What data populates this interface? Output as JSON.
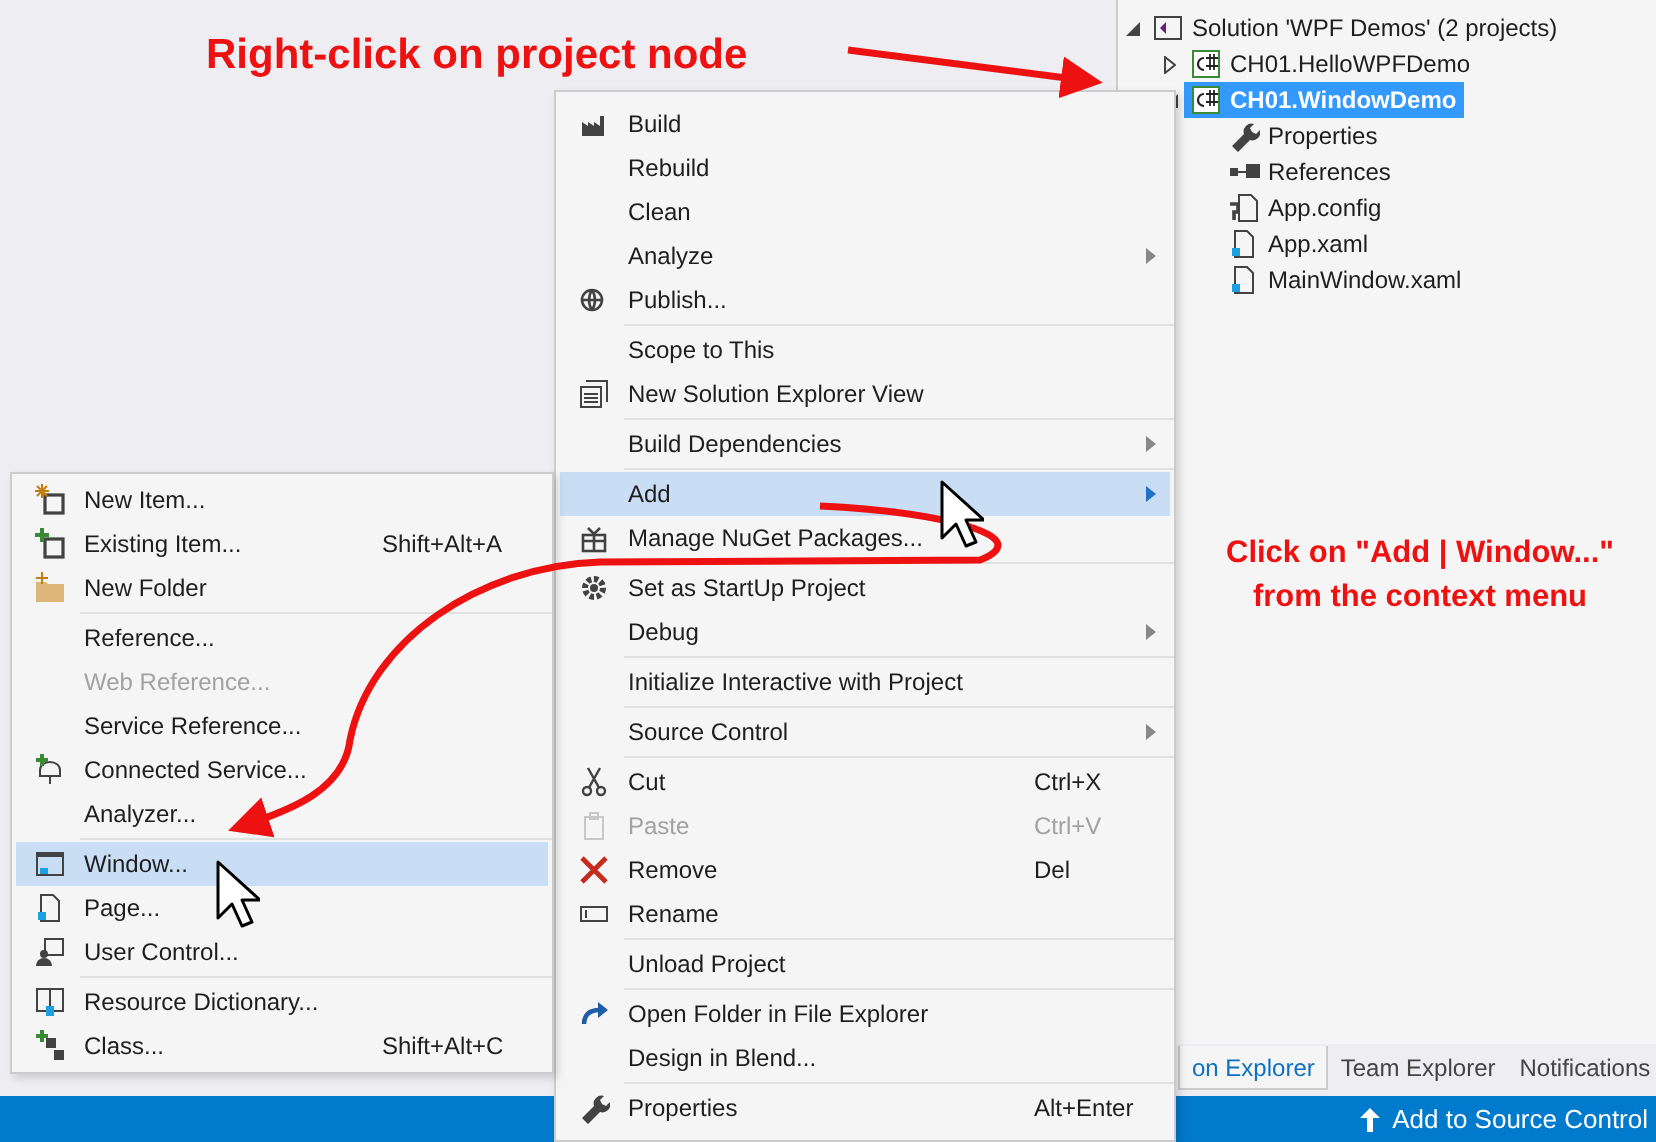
{
  "solution_explorer": {
    "tree": [
      {
        "label": "Solution 'WPF Demos' (2 projects)",
        "selected": false,
        "expanded": true,
        "children": [
          {
            "label": "CH01.HelloWPFDemo",
            "selected": false,
            "expanded": false
          },
          {
            "label": "CH01.WindowDemo",
            "selected": true,
            "expanded": true,
            "children": [
              {
                "label": "Properties",
                "selected": false
              },
              {
                "label": "References",
                "selected": false
              },
              {
                "label": "App.config",
                "selected": false
              },
              {
                "label": "App.xaml",
                "selected": false
              },
              {
                "label": "MainWindow.xaml",
                "selected": false
              }
            ]
          }
        ]
      }
    ],
    "tabs": [
      {
        "label": "on Explorer",
        "selected": true
      },
      {
        "label": "Team Explorer",
        "selected": false
      },
      {
        "label": "Notifications",
        "selected": false
      }
    ]
  },
  "status_bar": {
    "text": "Add to Source Control"
  },
  "context_menu": [
    {
      "kind": "item",
      "label": "Build",
      "submenu": false,
      "disabled": false,
      "selected": false
    },
    {
      "kind": "item",
      "label": "Rebuild",
      "submenu": false,
      "disabled": false,
      "selected": false
    },
    {
      "kind": "item",
      "label": "Clean",
      "submenu": false,
      "disabled": false,
      "selected": false
    },
    {
      "kind": "item",
      "label": "Analyze",
      "submenu": true,
      "disabled": false,
      "selected": false
    },
    {
      "kind": "item",
      "label": "Publish...",
      "submenu": false,
      "disabled": false,
      "selected": false
    },
    {
      "kind": "separator"
    },
    {
      "kind": "item",
      "label": "Scope to This",
      "submenu": false,
      "disabled": false,
      "selected": false
    },
    {
      "kind": "item",
      "label": "New Solution Explorer View",
      "submenu": false,
      "disabled": false,
      "selected": false
    },
    {
      "kind": "separator"
    },
    {
      "kind": "item",
      "label": "Build Dependencies",
      "submenu": true,
      "disabled": false,
      "selected": false
    },
    {
      "kind": "separator"
    },
    {
      "kind": "item",
      "label": "Add",
      "submenu": true,
      "disabled": false,
      "selected": true
    },
    {
      "kind": "item",
      "label": "Manage NuGet Packages...",
      "submenu": false,
      "disabled": false,
      "selected": false
    },
    {
      "kind": "separator"
    },
    {
      "kind": "item",
      "label": "Set as StartUp Project",
      "submenu": false,
      "disabled": false,
      "selected": false
    },
    {
      "kind": "item",
      "label": "Debug",
      "submenu": true,
      "disabled": false,
      "selected": false
    },
    {
      "kind": "separator"
    },
    {
      "kind": "item",
      "label": "Initialize Interactive with Project",
      "submenu": false,
      "disabled": false,
      "selected": false
    },
    {
      "kind": "separator"
    },
    {
      "kind": "item",
      "label": "Source Control",
      "submenu": true,
      "disabled": false,
      "selected": false
    },
    {
      "kind": "separator"
    },
    {
      "kind": "item",
      "label": "Cut",
      "shortcut": "Ctrl+X",
      "submenu": false,
      "disabled": false,
      "selected": false
    },
    {
      "kind": "item",
      "label": "Paste",
      "shortcut": "Ctrl+V",
      "submenu": false,
      "disabled": true,
      "selected": false
    },
    {
      "kind": "item",
      "label": "Remove",
      "shortcut": "Del",
      "submenu": false,
      "disabled": false,
      "selected": false
    },
    {
      "kind": "item",
      "label": "Rename",
      "submenu": false,
      "disabled": false,
      "selected": false
    },
    {
      "kind": "separator"
    },
    {
      "kind": "item",
      "label": "Unload Project",
      "submenu": false,
      "disabled": false,
      "selected": false
    },
    {
      "kind": "separator"
    },
    {
      "kind": "item",
      "label": "Open Folder in File Explorer",
      "submenu": false,
      "disabled": false,
      "selected": false
    },
    {
      "kind": "item",
      "label": "Design in Blend...",
      "submenu": false,
      "disabled": false,
      "selected": false
    },
    {
      "kind": "separator"
    },
    {
      "kind": "item",
      "label": "Properties",
      "shortcut": "Alt+Enter",
      "submenu": false,
      "disabled": false,
      "selected": false
    }
  ],
  "add_submenu": [
    {
      "kind": "item",
      "label": "New Item...",
      "disabled": false,
      "selected": false
    },
    {
      "kind": "item",
      "label": "Existing Item...",
      "shortcut": "Shift+Alt+A",
      "disabled": false,
      "selected": false
    },
    {
      "kind": "item",
      "label": "New Folder",
      "disabled": false,
      "selected": false
    },
    {
      "kind": "separator"
    },
    {
      "kind": "item",
      "label": "Reference...",
      "disabled": false,
      "selected": false
    },
    {
      "kind": "item",
      "label": "Web Reference...",
      "disabled": true,
      "selected": false
    },
    {
      "kind": "item",
      "label": "Service Reference...",
      "disabled": false,
      "selected": false
    },
    {
      "kind": "item",
      "label": "Connected Service...",
      "disabled": false,
      "selected": false
    },
    {
      "kind": "item",
      "label": "Analyzer...",
      "disabled": false,
      "selected": false
    },
    {
      "kind": "separator"
    },
    {
      "kind": "item",
      "label": "Window...",
      "disabled": false,
      "selected": true
    },
    {
      "kind": "item",
      "label": "Page...",
      "disabled": false,
      "selected": false
    },
    {
      "kind": "item",
      "label": "User Control...",
      "disabled": false,
      "selected": false
    },
    {
      "kind": "separator"
    },
    {
      "kind": "item",
      "label": "Resource Dictionary...",
      "disabled": false,
      "selected": false
    },
    {
      "kind": "item",
      "label": "Class...",
      "shortcut": "Shift+Alt+C",
      "disabled": false,
      "selected": false
    }
  ],
  "annotations": [
    {
      "kind": "top",
      "text": "Right-click on project node"
    },
    {
      "kind": "side",
      "lines": [
        "Click on \"Add | Window...\"",
        "from the context menu"
      ]
    }
  ]
}
